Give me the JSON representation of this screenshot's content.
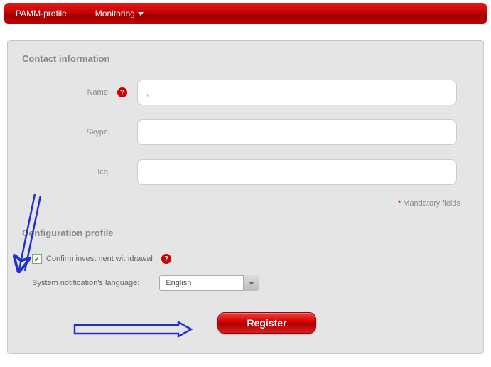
{
  "nav": {
    "items": [
      {
        "label": "PAMM-profile"
      },
      {
        "label": "Monitoring"
      }
    ]
  },
  "sections": {
    "contact_title": "Contact information",
    "config_title": "Configuration profile"
  },
  "fields": {
    "name": {
      "label": "Name:",
      "value": ","
    },
    "skype": {
      "label": "Skype:",
      "value": ""
    },
    "icq": {
      "label": "Icq:",
      "value": ""
    }
  },
  "mandatory_note": "Mandatory fields",
  "checkbox": {
    "label": "Confirm investment withdrawal",
    "checked": true
  },
  "language": {
    "label": "System notification's language:",
    "selected": "English"
  },
  "register_label": "Register",
  "help_marker": "?",
  "check_marker": "✓",
  "star": "*"
}
